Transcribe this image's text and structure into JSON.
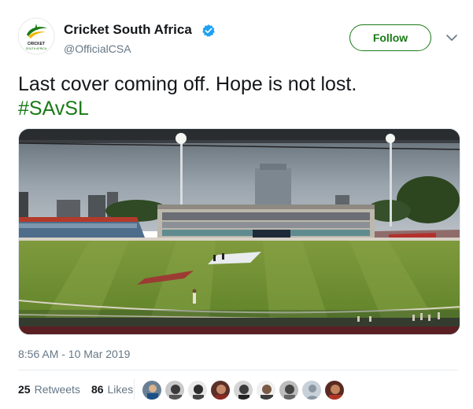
{
  "author": {
    "name": "Cricket South Africa",
    "handle": "@OfficialCSA",
    "logo_text_top": "CRICKET",
    "logo_text_bottom": "SOUTH AFRICA",
    "verified_icon": "verified-badge-icon"
  },
  "actions": {
    "follow_label": "Follow",
    "menu_icon": "chevron-down-icon"
  },
  "tweet": {
    "text_line1": "Last cover coming off. Hope is not lost.",
    "hashtag": "#SAvSL",
    "media_description_icon": "stadium-photo"
  },
  "meta": {
    "timestamp": "8:56 AM - 10 Mar 2019"
  },
  "stats": {
    "retweets_count": "25",
    "retweets_label": "Retweets",
    "likes_count": "86",
    "likes_label": "Likes"
  },
  "colors": {
    "brand_green": "#1a7a16",
    "text_primary": "#14171a",
    "text_secondary": "#657786",
    "verified_blue": "#1da1f2"
  }
}
